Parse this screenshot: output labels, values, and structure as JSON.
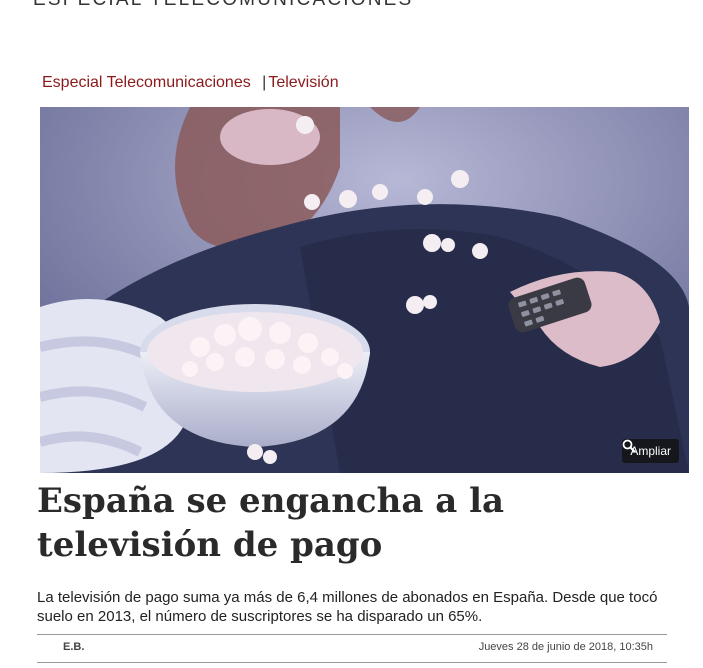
{
  "header": {
    "section_title": "ESPECIAL TELECOMUNICACIONES"
  },
  "breadcrumb": {
    "section": "Especial Telecomunicaciones",
    "separator": "|",
    "category": "Televisión"
  },
  "photo": {
    "zoom_label": "Ampliar"
  },
  "article": {
    "headline": "España se engancha a la televisión de pago",
    "subtitle": "La televisión de pago suma ya más de 6,4 millones de abonados en España. Desde que tocó suelo en 2013, el número de suscriptores se ha disparado un 65%.",
    "author": "E.B.",
    "date": "Jueves 28 de junio de 2018, 10:35h"
  },
  "colors": {
    "accent": "#8b1a1a",
    "text": "#222222",
    "headline": "#2a2a2a"
  }
}
